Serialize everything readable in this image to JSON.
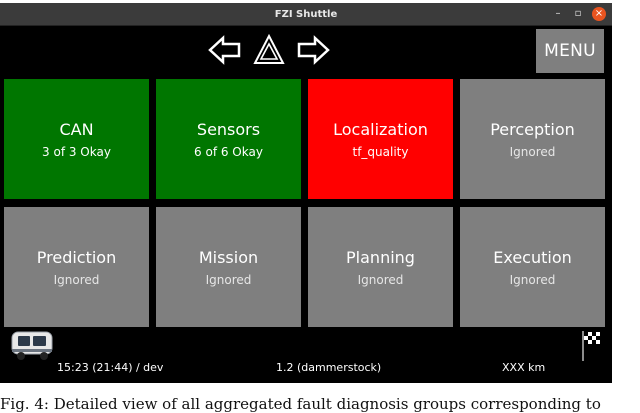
{
  "window": {
    "title": "FZI Shuttle",
    "buttons": {
      "minimize": "–",
      "maximize": "▫",
      "close": "×"
    }
  },
  "nav": {
    "left_icon": "arrow-left-outline-icon",
    "hazard_icon": "hazard-triangle-icon",
    "right_icon": "arrow-right-outline-icon",
    "menu_label": "MENU"
  },
  "colors": {
    "ok_green": "#007600",
    "fault_red": "#ff0000",
    "ignored_gray": "#7f7f7f",
    "background": "#000000"
  },
  "tiles": [
    {
      "name": "CAN",
      "status": "3 of 3 Okay",
      "state": "ok"
    },
    {
      "name": "Sensors",
      "status": "6 of 6 Okay",
      "state": "ok"
    },
    {
      "name": "Localization",
      "status": "tf_quality",
      "state": "fault"
    },
    {
      "name": "Perception",
      "status": "Ignored",
      "state": "ignored"
    },
    {
      "name": "Prediction",
      "status": "Ignored",
      "state": "ignored"
    },
    {
      "name": "Mission",
      "status": "Ignored",
      "state": "ignored"
    },
    {
      "name": "Planning",
      "status": "Ignored",
      "state": "ignored"
    },
    {
      "name": "Execution",
      "status": "Ignored",
      "state": "ignored"
    }
  ],
  "statusbar": {
    "vehicle_icon": "shuttle-vehicle-icon",
    "time": "15:23 (21:44) / dev",
    "version": "1.2 (dammerstock)",
    "distance": "XXX km",
    "flag_icon": "checkered-flag-icon"
  },
  "caption": "Fig. 4: Detailed view of all aggregated fault diagnosis groups corresponding to"
}
